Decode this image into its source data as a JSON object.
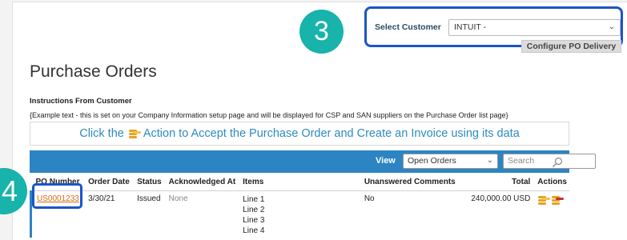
{
  "callouts": {
    "three": "3",
    "four": "4"
  },
  "customer": {
    "label": "Select Customer",
    "value": "INTUIT -",
    "configure_button": "Configure PO Delivery"
  },
  "page": {
    "title": "Purchase Orders",
    "instructions_heading": "Instructions From Customer",
    "instructions_text": "{Example text - this is set on your Company Information setup page and will be displayed for CSP and SAN suppliers on the Purchase Order list page}",
    "banner_prefix": "Click the",
    "banner_suffix": "Action to Accept the Purchase Order and Create an Invoice using its data",
    "banner_icon": "coin-stack-icon"
  },
  "toolbar": {
    "view_label": "View",
    "view_value": "Open Orders",
    "search_placeholder": "Search"
  },
  "table": {
    "columns": [
      "PO Number",
      "Order Date",
      "Status",
      "Acknowledged At",
      "Items",
      "Unanswered Comments",
      "Total",
      "Actions"
    ],
    "rows": [
      {
        "po_number": "US0001233",
        "order_date": "3/30/21",
        "status": "Issued",
        "acknowledged_at": "None",
        "items": [
          "Line 1",
          "Line 2",
          "Line 3",
          "Line 4"
        ],
        "unanswered_comments": "No",
        "total": "240,000.00 USD",
        "actions": [
          "accept-invoice-icon",
          "reject-icon"
        ]
      }
    ]
  },
  "colors": {
    "accent": "#2d84c3",
    "callout": "#18b3aa",
    "highlight_box": "#1a55c9",
    "link": "#d66a12"
  }
}
